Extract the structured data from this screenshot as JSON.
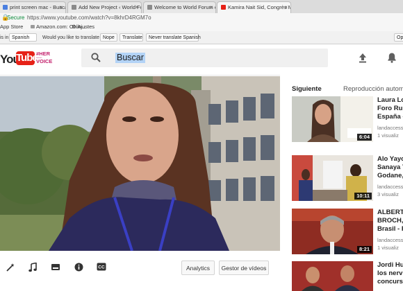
{
  "browser": {
    "tabs": [
      {
        "title": "print screen mac - Buscar co",
        "favicon_color": "#4a7fe0",
        "active": false
      },
      {
        "title": "Add New Project ‹ World Foru",
        "favicon_color": "#8a8a8a",
        "active": false
      },
      {
        "title": "Welcome to World Forum on",
        "favicon_color": "#8a8a8a",
        "active": false
      },
      {
        "title": "Kamira Nait Sid, Congrès Mon",
        "favicon_color": "#e62117",
        "active": true
      }
    ],
    "close_glyph": "×",
    "address": {
      "secure_label": "Secure",
      "url": "https://www.youtube.com/watch?v=8khrD4RGM7o"
    },
    "bookmarks": [
      "App Store",
      "Amazon.com: Onlin...",
      "Ajustes"
    ],
    "translate_bar": {
      "prefix": "is in",
      "language": "Spanish",
      "question": "Would you like to translate it?",
      "nope": "Nope",
      "translate": "Translate",
      "never": "Never translate Spanish",
      "options": "Op"
    }
  },
  "youtube": {
    "logo_you": "You",
    "logo_tube": "Tube",
    "logo_tag_lines": [
      "#HER",
      "VOICE"
    ],
    "search_placeholder": "Buscar",
    "controls": {
      "analytics": "Analytics",
      "video_manager": "Gestor de vídeos"
    },
    "sidebar": {
      "up_next": "Siguiente",
      "autoplay": "Reproducción automa",
      "videos": [
        {
          "title_lines": [
            "Laura Lo",
            "Foro Rur",
            "España -"
          ],
          "meta_lines": [
            "landaccess",
            "1 visualiz"
          ],
          "duration": "6:04"
        },
        {
          "title_lines": [
            "Alo Yayo",
            "Sanaya Y",
            "Godane,"
          ],
          "meta_lines": [
            "landaccess",
            "3 visualiz"
          ],
          "duration": "10:11"
        },
        {
          "title_lines": [
            "ALBERTO",
            "BROCH,",
            "Brasil - F"
          ],
          "meta_lines": [
            "landaccess",
            "1 visualiz"
          ],
          "duration": "8:21"
        },
        {
          "title_lines": [
            "Jordi Hu",
            "los nervi",
            "concursa"
          ],
          "meta_lines": [],
          "duration": ""
        }
      ]
    }
  },
  "colors": {
    "brand_red": "#e62117",
    "secure_green": "#0a8a3a",
    "search_highlight": "#b3d3f6"
  }
}
